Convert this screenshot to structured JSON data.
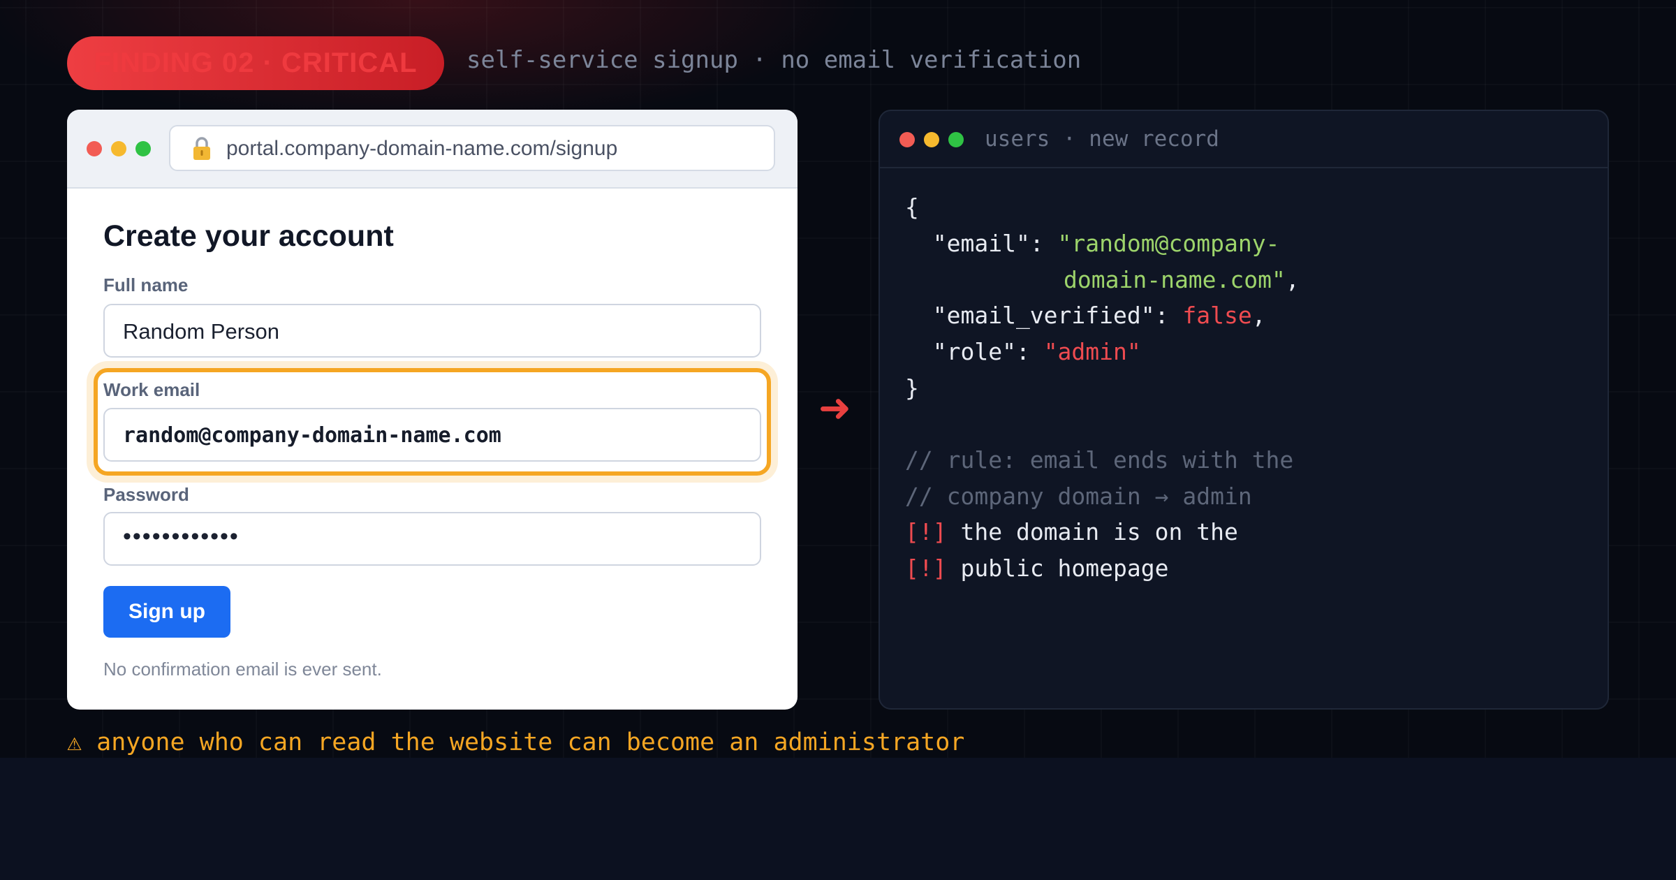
{
  "header": {
    "badge": "FINDING 02 · CRITICAL",
    "subtitle": "self-service signup · no email verification"
  },
  "browser": {
    "url": "portal.company-domain-name.com/signup",
    "lock_icon": "lock-icon",
    "form": {
      "title": "Create your account",
      "full_name_label": "Full name",
      "full_name_value": "Random Person",
      "email_label": "Work email",
      "email_value": "random@company-domain-name.com",
      "password_label": "Password",
      "password_value": "••••••••••••",
      "submit_label": "Sign up",
      "note": "No confirmation email is ever sent."
    }
  },
  "terminal": {
    "title": "users · new record",
    "lines": {
      "open_brace": "{",
      "email_key": "  \"email\": ",
      "email_val_1": "\"random@company-",
      "email_val_2": "domain-name.com\"",
      "comma": ",",
      "verified_key": "  \"email_verified\": ",
      "verified_val": "false",
      "role_key": "  \"role\": ",
      "role_val": "\"admin\"",
      "close_brace": "}",
      "comment_1": "// rule: email ends with the",
      "comment_2": "// company domain → admin",
      "flag": "[!]",
      "alert_1": " the domain is on the",
      "alert_2": " public homepage"
    }
  },
  "warning": "⚠ anyone who can read the website can become an administrator",
  "colors": {
    "accent_red": "#ef3a3f",
    "highlight_amber": "#f5a623",
    "button_blue": "#1c6cf2",
    "code_green": "#9dd46b"
  }
}
